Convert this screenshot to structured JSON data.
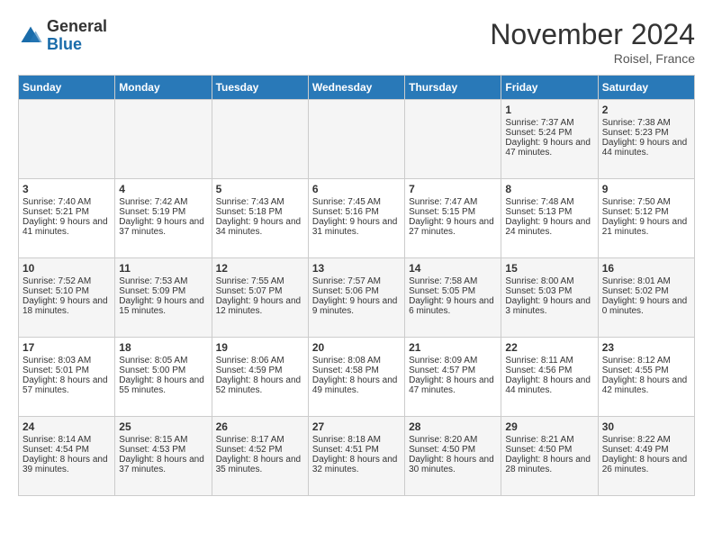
{
  "header": {
    "logo_general": "General",
    "logo_blue": "Blue",
    "month_year": "November 2024",
    "location": "Roisel, France"
  },
  "days_of_week": [
    "Sunday",
    "Monday",
    "Tuesday",
    "Wednesday",
    "Thursday",
    "Friday",
    "Saturday"
  ],
  "weeks": [
    [
      {
        "day": "",
        "sunrise": "",
        "sunset": "",
        "daylight": ""
      },
      {
        "day": "",
        "sunrise": "",
        "sunset": "",
        "daylight": ""
      },
      {
        "day": "",
        "sunrise": "",
        "sunset": "",
        "daylight": ""
      },
      {
        "day": "",
        "sunrise": "",
        "sunset": "",
        "daylight": ""
      },
      {
        "day": "",
        "sunrise": "",
        "sunset": "",
        "daylight": ""
      },
      {
        "day": "1",
        "sunrise": "Sunrise: 7:37 AM",
        "sunset": "Sunset: 5:24 PM",
        "daylight": "Daylight: 9 hours and 47 minutes."
      },
      {
        "day": "2",
        "sunrise": "Sunrise: 7:38 AM",
        "sunset": "Sunset: 5:23 PM",
        "daylight": "Daylight: 9 hours and 44 minutes."
      }
    ],
    [
      {
        "day": "3",
        "sunrise": "Sunrise: 7:40 AM",
        "sunset": "Sunset: 5:21 PM",
        "daylight": "Daylight: 9 hours and 41 minutes."
      },
      {
        "day": "4",
        "sunrise": "Sunrise: 7:42 AM",
        "sunset": "Sunset: 5:19 PM",
        "daylight": "Daylight: 9 hours and 37 minutes."
      },
      {
        "day": "5",
        "sunrise": "Sunrise: 7:43 AM",
        "sunset": "Sunset: 5:18 PM",
        "daylight": "Daylight: 9 hours and 34 minutes."
      },
      {
        "day": "6",
        "sunrise": "Sunrise: 7:45 AM",
        "sunset": "Sunset: 5:16 PM",
        "daylight": "Daylight: 9 hours and 31 minutes."
      },
      {
        "day": "7",
        "sunrise": "Sunrise: 7:47 AM",
        "sunset": "Sunset: 5:15 PM",
        "daylight": "Daylight: 9 hours and 27 minutes."
      },
      {
        "day": "8",
        "sunrise": "Sunrise: 7:48 AM",
        "sunset": "Sunset: 5:13 PM",
        "daylight": "Daylight: 9 hours and 24 minutes."
      },
      {
        "day": "9",
        "sunrise": "Sunrise: 7:50 AM",
        "sunset": "Sunset: 5:12 PM",
        "daylight": "Daylight: 9 hours and 21 minutes."
      }
    ],
    [
      {
        "day": "10",
        "sunrise": "Sunrise: 7:52 AM",
        "sunset": "Sunset: 5:10 PM",
        "daylight": "Daylight: 9 hours and 18 minutes."
      },
      {
        "day": "11",
        "sunrise": "Sunrise: 7:53 AM",
        "sunset": "Sunset: 5:09 PM",
        "daylight": "Daylight: 9 hours and 15 minutes."
      },
      {
        "day": "12",
        "sunrise": "Sunrise: 7:55 AM",
        "sunset": "Sunset: 5:07 PM",
        "daylight": "Daylight: 9 hours and 12 minutes."
      },
      {
        "day": "13",
        "sunrise": "Sunrise: 7:57 AM",
        "sunset": "Sunset: 5:06 PM",
        "daylight": "Daylight: 9 hours and 9 minutes."
      },
      {
        "day": "14",
        "sunrise": "Sunrise: 7:58 AM",
        "sunset": "Sunset: 5:05 PM",
        "daylight": "Daylight: 9 hours and 6 minutes."
      },
      {
        "day": "15",
        "sunrise": "Sunrise: 8:00 AM",
        "sunset": "Sunset: 5:03 PM",
        "daylight": "Daylight: 9 hours and 3 minutes."
      },
      {
        "day": "16",
        "sunrise": "Sunrise: 8:01 AM",
        "sunset": "Sunset: 5:02 PM",
        "daylight": "Daylight: 9 hours and 0 minutes."
      }
    ],
    [
      {
        "day": "17",
        "sunrise": "Sunrise: 8:03 AM",
        "sunset": "Sunset: 5:01 PM",
        "daylight": "Daylight: 8 hours and 57 minutes."
      },
      {
        "day": "18",
        "sunrise": "Sunrise: 8:05 AM",
        "sunset": "Sunset: 5:00 PM",
        "daylight": "Daylight: 8 hours and 55 minutes."
      },
      {
        "day": "19",
        "sunrise": "Sunrise: 8:06 AM",
        "sunset": "Sunset: 4:59 PM",
        "daylight": "Daylight: 8 hours and 52 minutes."
      },
      {
        "day": "20",
        "sunrise": "Sunrise: 8:08 AM",
        "sunset": "Sunset: 4:58 PM",
        "daylight": "Daylight: 8 hours and 49 minutes."
      },
      {
        "day": "21",
        "sunrise": "Sunrise: 8:09 AM",
        "sunset": "Sunset: 4:57 PM",
        "daylight": "Daylight: 8 hours and 47 minutes."
      },
      {
        "day": "22",
        "sunrise": "Sunrise: 8:11 AM",
        "sunset": "Sunset: 4:56 PM",
        "daylight": "Daylight: 8 hours and 44 minutes."
      },
      {
        "day": "23",
        "sunrise": "Sunrise: 8:12 AM",
        "sunset": "Sunset: 4:55 PM",
        "daylight": "Daylight: 8 hours and 42 minutes."
      }
    ],
    [
      {
        "day": "24",
        "sunrise": "Sunrise: 8:14 AM",
        "sunset": "Sunset: 4:54 PM",
        "daylight": "Daylight: 8 hours and 39 minutes."
      },
      {
        "day": "25",
        "sunrise": "Sunrise: 8:15 AM",
        "sunset": "Sunset: 4:53 PM",
        "daylight": "Daylight: 8 hours and 37 minutes."
      },
      {
        "day": "26",
        "sunrise": "Sunrise: 8:17 AM",
        "sunset": "Sunset: 4:52 PM",
        "daylight": "Daylight: 8 hours and 35 minutes."
      },
      {
        "day": "27",
        "sunrise": "Sunrise: 8:18 AM",
        "sunset": "Sunset: 4:51 PM",
        "daylight": "Daylight: 8 hours and 32 minutes."
      },
      {
        "day": "28",
        "sunrise": "Sunrise: 8:20 AM",
        "sunset": "Sunset: 4:50 PM",
        "daylight": "Daylight: 8 hours and 30 minutes."
      },
      {
        "day": "29",
        "sunrise": "Sunrise: 8:21 AM",
        "sunset": "Sunset: 4:50 PM",
        "daylight": "Daylight: 8 hours and 28 minutes."
      },
      {
        "day": "30",
        "sunrise": "Sunrise: 8:22 AM",
        "sunset": "Sunset: 4:49 PM",
        "daylight": "Daylight: 8 hours and 26 minutes."
      }
    ]
  ]
}
